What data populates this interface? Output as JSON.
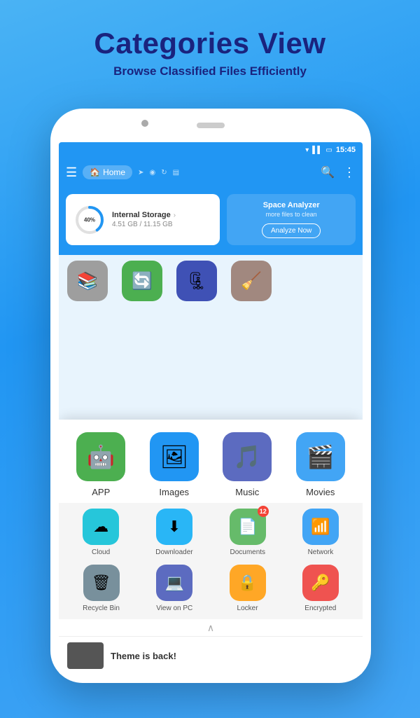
{
  "page": {
    "title": "Categories View",
    "subtitle": "Browse Classified Files Efficiently"
  },
  "status_bar": {
    "time": "15:45"
  },
  "app_bar": {
    "home_label": "Home",
    "hamburger": "☰",
    "search_icon": "🔍",
    "more_icon": "⋮"
  },
  "storage": {
    "percent": "40%",
    "title": "Internal Storage",
    "size": "4.51 GB / 11.15 GB",
    "analyzer_title": "Space Analyzer",
    "analyzer_sub": "more files to clean",
    "analyze_btn": "Analyze Now"
  },
  "categories_top": [
    {
      "label": "APP",
      "color": "#4caf50",
      "emoji": "🤖"
    },
    {
      "label": "Images",
      "color": "#2196f3",
      "emoji": "🖼"
    },
    {
      "label": "Music",
      "color": "#5c6bc0",
      "emoji": "🎵"
    },
    {
      "label": "Movies",
      "color": "#42a5f5",
      "emoji": "🎬"
    }
  ],
  "categories_mid": [
    {
      "label": "Cloud",
      "color": "#26c6da",
      "emoji": "☁",
      "badge": null
    },
    {
      "label": "Downloader",
      "color": "#29b6f6",
      "emoji": "⬇",
      "badge": null
    },
    {
      "label": "Documents",
      "color": "#66bb6a",
      "emoji": "📄",
      "badge": "12"
    },
    {
      "label": "Network",
      "color": "#42a5f5",
      "emoji": "📶",
      "badge": null
    }
  ],
  "categories_bot": [
    {
      "label": "Recycle Bin",
      "color": "#78909c",
      "emoji": "🗑",
      "badge": null
    },
    {
      "label": "View on PC",
      "color": "#5c6bc0",
      "emoji": "💻",
      "badge": null
    },
    {
      "label": "Locker",
      "color": "#ffa726",
      "emoji": "🔒",
      "badge": null
    },
    {
      "label": "Encrypted",
      "color": "#ef5350",
      "emoji": "🔑",
      "badge": null
    }
  ],
  "partial_icons": [
    {
      "color": "#9e9e9e",
      "emoji": "📚"
    },
    {
      "color": "#4caf50",
      "emoji": "🔄"
    },
    {
      "color": "#3f51b5",
      "emoji": "🗜"
    },
    {
      "color": "#a1887f",
      "emoji": "🧹"
    }
  ],
  "news": {
    "text": "Theme is back!"
  }
}
